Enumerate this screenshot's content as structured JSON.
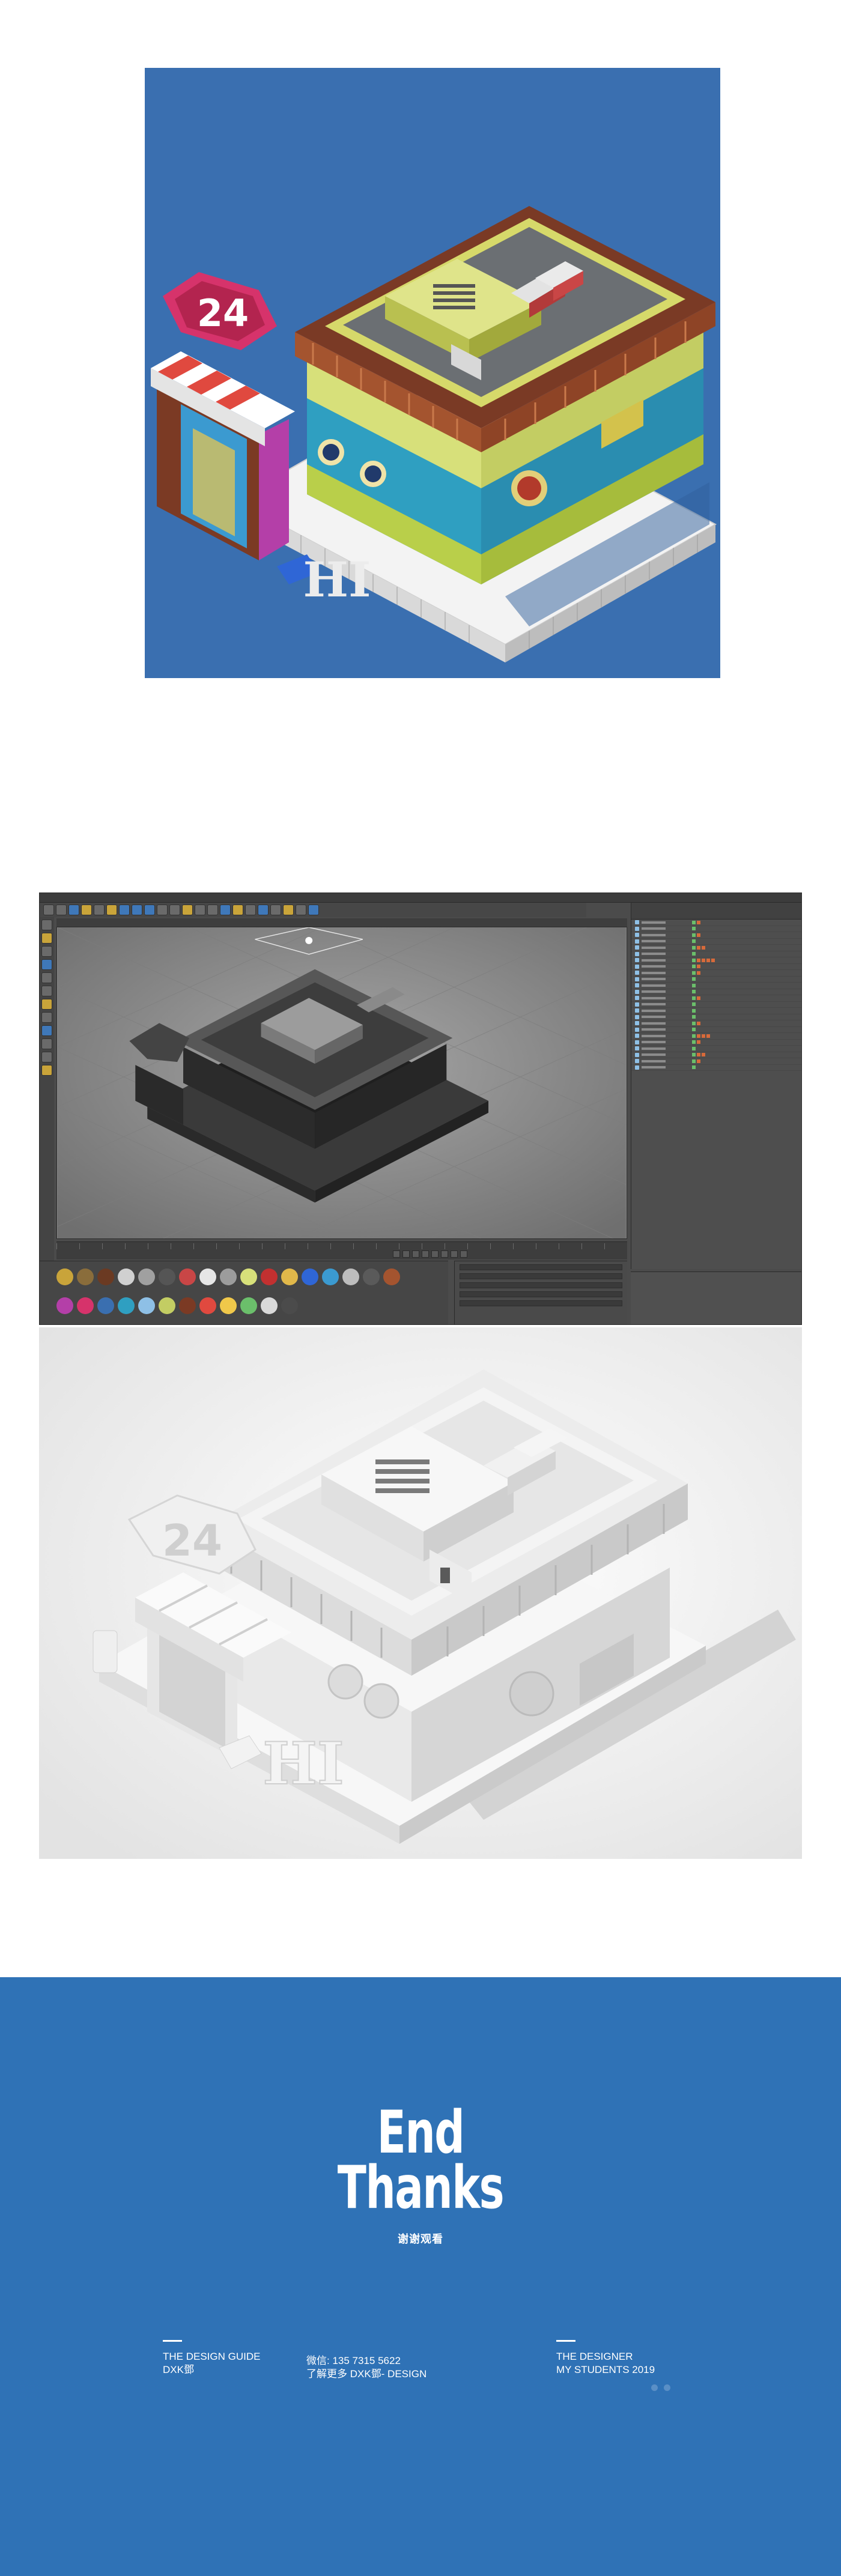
{
  "end_block": {
    "line1": "End",
    "line2": "Thanks",
    "subtitle": "谢谢观看"
  },
  "footer": {
    "col1": {
      "line1": "THE DESIGN GUIDE",
      "line2": "DXK鄧"
    },
    "col2": {
      "line1": "微信: 135 7315 5622",
      "line2": "了解更多    DXK鄧- DESIGN"
    },
    "col3": {
      "line1": "THE DESIGNER",
      "line2": "MY STUDENTS    2019"
    },
    "colors": {
      "background": "#2f72b6",
      "text": "#ffffff"
    }
  },
  "colored_render": {
    "sign_text": "24",
    "door_text": "HI",
    "background": "#3a6fb0"
  },
  "clay_render": {
    "sign_text": "24",
    "door_text": "HI"
  }
}
